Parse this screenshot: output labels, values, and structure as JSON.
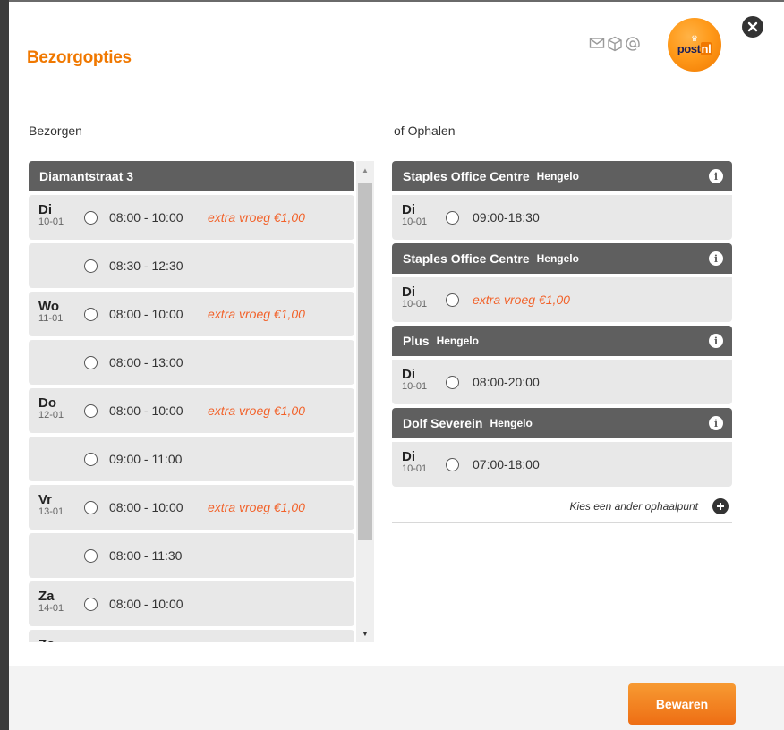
{
  "header": {
    "title": "Bezorgopties"
  },
  "logo": {
    "crown": "♛",
    "word_main": "post",
    "word_accent": "nl"
  },
  "icons": {
    "channel": [
      "mail-icon",
      "package-icon",
      "at-icon"
    ],
    "close": "close-icon",
    "info": "info-icon",
    "add": "plus-circle-icon"
  },
  "colors": {
    "accent": "#f07800",
    "header_bar": "#5f5f5f",
    "slot_bg": "#e8e8e8",
    "extra_text": "#f2622a"
  },
  "delivery": {
    "label": "Bezorgen",
    "address": "Diamantstraat 3",
    "slots": [
      {
        "day": "Di",
        "date": "10-01",
        "time": "08:00 - 10:00",
        "extra": "extra vroeg €1,00"
      },
      {
        "day": "",
        "date": "",
        "time": "08:30 - 12:30",
        "extra": ""
      },
      {
        "day": "Wo",
        "date": "11-01",
        "time": "08:00 - 10:00",
        "extra": "extra vroeg €1,00"
      },
      {
        "day": "",
        "date": "",
        "time": "08:00 - 13:00",
        "extra": ""
      },
      {
        "day": "Do",
        "date": "12-01",
        "time": "08:00 - 10:00",
        "extra": "extra vroeg €1,00"
      },
      {
        "day": "",
        "date": "",
        "time": "09:00 - 11:00",
        "extra": ""
      },
      {
        "day": "Vr",
        "date": "13-01",
        "time": "08:00 - 10:00",
        "extra": "extra vroeg €1,00"
      },
      {
        "day": "",
        "date": "",
        "time": "08:00 - 11:30",
        "extra": ""
      },
      {
        "day": "Za",
        "date": "14-01",
        "time": "08:00 - 10:00",
        "extra": ""
      },
      {
        "day": "Zo",
        "date": "",
        "time": "",
        "extra": ""
      }
    ]
  },
  "pickup": {
    "label": "of Ophalen",
    "points": [
      {
        "name": "Staples Office Centre",
        "city": "Hengelo",
        "day": "Di",
        "date": "10-01",
        "time": "09:00-18:30",
        "extra": ""
      },
      {
        "name": "Staples Office Centre",
        "city": "Hengelo",
        "day": "Di",
        "date": "10-01",
        "time": "",
        "extra": "extra vroeg €1,00"
      },
      {
        "name": "Plus",
        "city": "Hengelo",
        "day": "Di",
        "date": "10-01",
        "time": "08:00-20:00",
        "extra": ""
      },
      {
        "name": "Dolf Severein",
        "city": "Hengelo",
        "day": "Di",
        "date": "10-01",
        "time": "07:00-18:00",
        "extra": ""
      }
    ],
    "other_link": "Kies een ander ophaalpunt"
  },
  "footer": {
    "save_label": "Bewaren"
  }
}
